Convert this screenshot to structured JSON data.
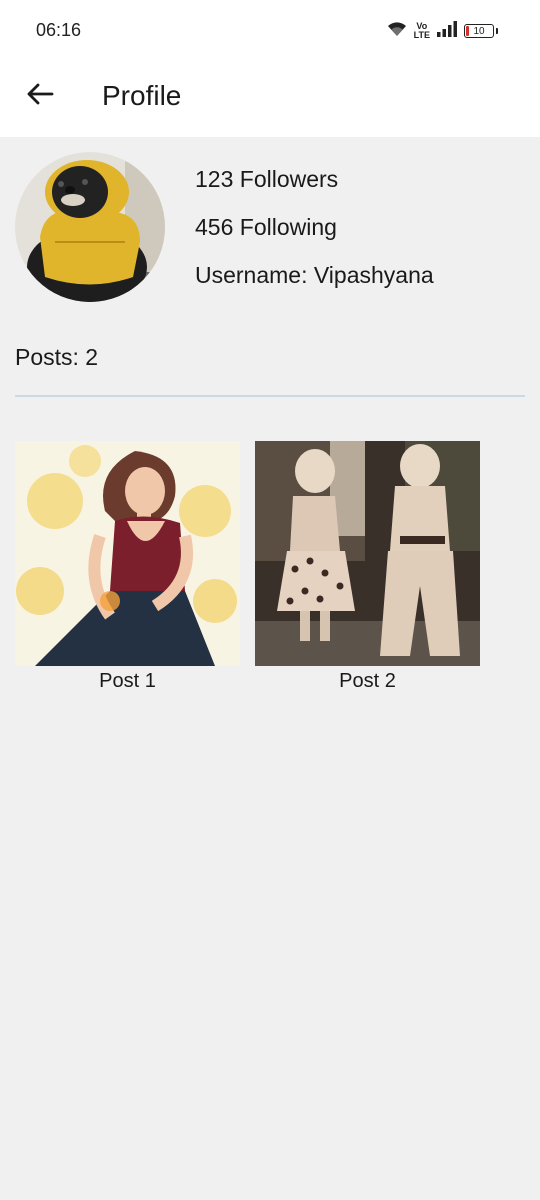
{
  "status_bar": {
    "time": "06:16",
    "volte_top": "Vo",
    "volte_bottom": "LTE",
    "battery_level": "10",
    "icons": [
      "wifi-icon",
      "volte-icon",
      "signal-icon",
      "battery-icon"
    ],
    "battery_color": "#d32f2f"
  },
  "app_bar": {
    "back_icon": "arrow-left-icon",
    "title": "Profile"
  },
  "profile": {
    "avatar_icon": "profile-photo",
    "followers": "123 Followers",
    "following": "456 Following",
    "username": "Username: Vipashyana"
  },
  "posts": {
    "count_label": "Posts: 2",
    "items": [
      {
        "label": "Post 1"
      },
      {
        "label": "Post 2"
      }
    ]
  },
  "colors": {
    "background": "#f0f0f0",
    "app_bar": "#ffffff",
    "divider": "#c9d9e8"
  }
}
